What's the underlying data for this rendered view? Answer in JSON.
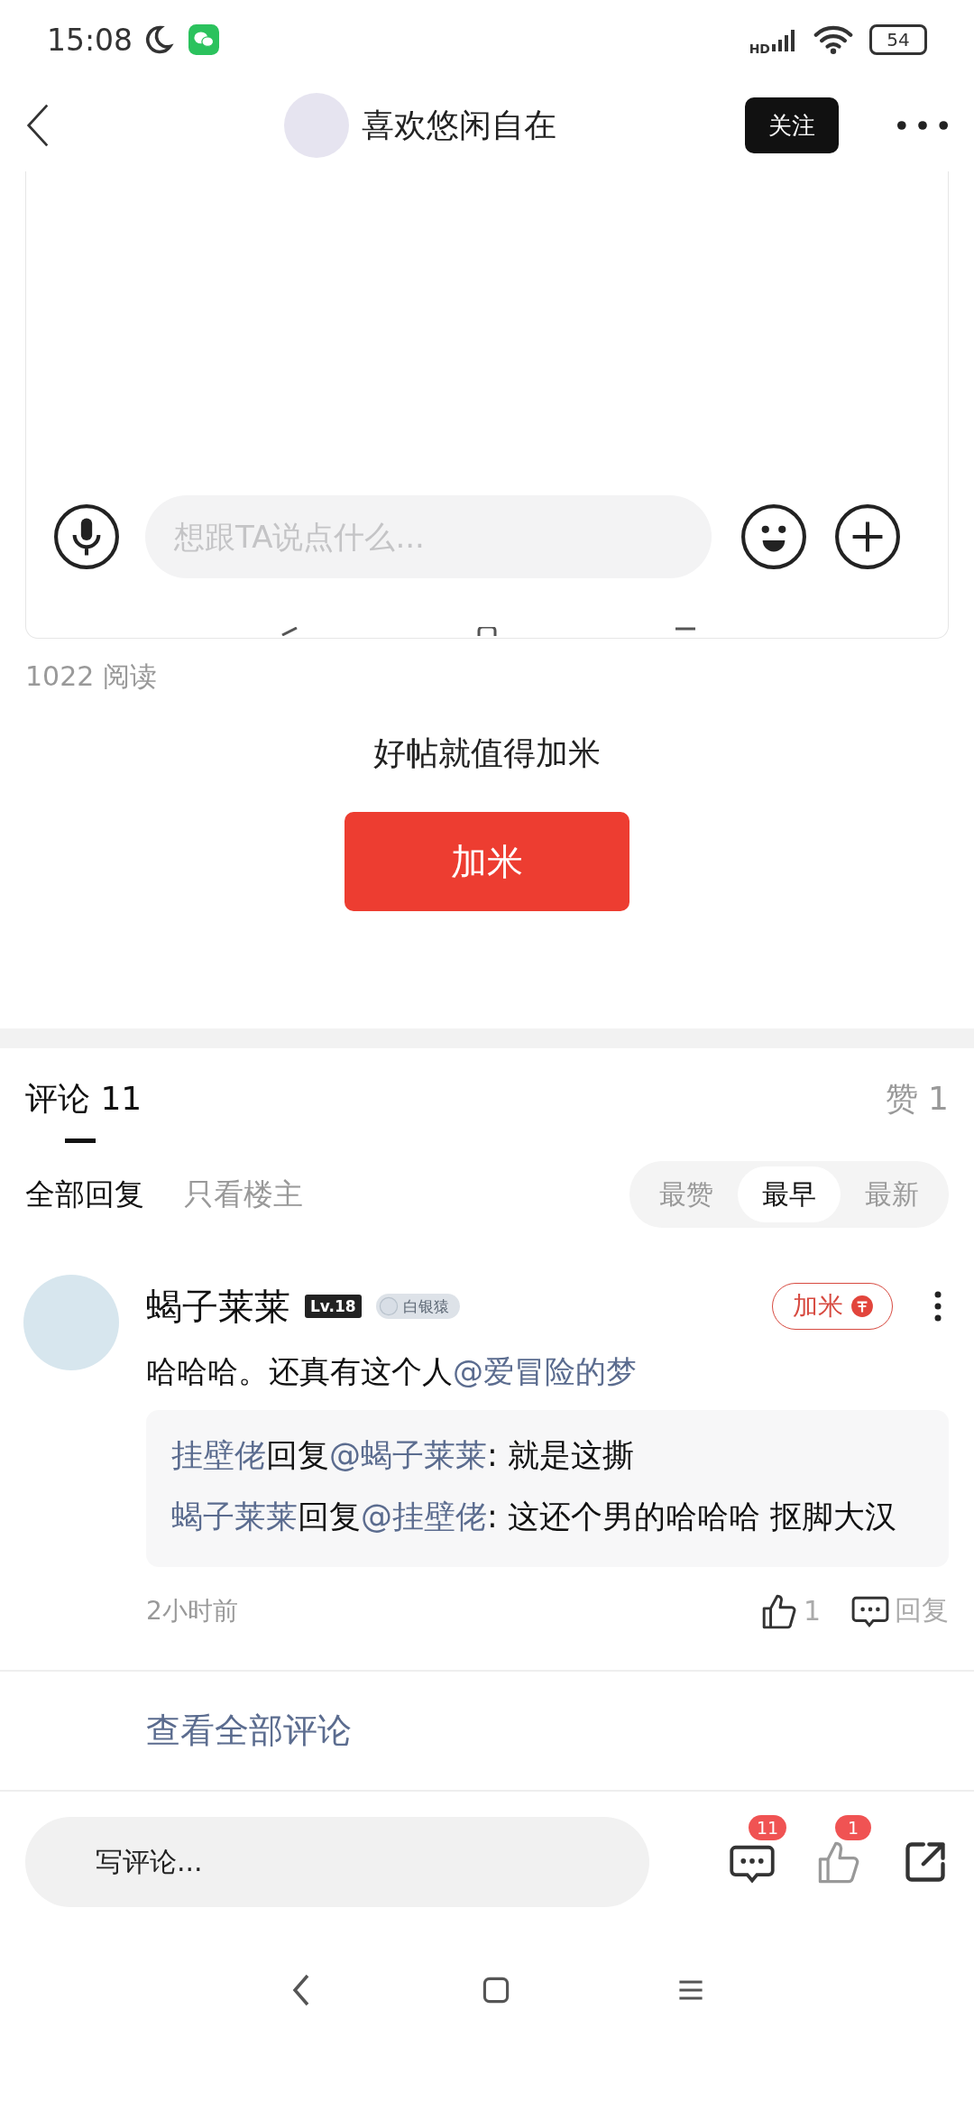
{
  "status_bar": {
    "time": "15:08",
    "network": "HD",
    "battery": "54"
  },
  "header": {
    "title": "喜欢悠闲自在",
    "follow_button": "关注"
  },
  "embedded_screenshot": {
    "placeholder": "想跟TA说点什么..."
  },
  "read_count": "1022 阅读",
  "reward": {
    "prompt": "好帖就值得加米",
    "button": "加米"
  },
  "tabs": [
    {
      "label": "评论 11",
      "selected": true
    },
    {
      "label": "赞 1",
      "selected": false
    }
  ],
  "filters": [
    {
      "label": "全部回复",
      "selected": true
    },
    {
      "label": "只看楼主",
      "selected": false
    }
  ],
  "sort": [
    {
      "label": "最赞",
      "selected": false
    },
    {
      "label": "最早",
      "selected": true
    },
    {
      "label": "最新",
      "selected": false
    }
  ],
  "comment": {
    "author": "蝎子莱莱",
    "level": "Lv.18",
    "badge": "白银猿",
    "reward_button": "加米",
    "text": "哈哈哈。还真有这个人",
    "mention": "@爱冒险的梦",
    "replies": [
      {
        "author": "挂壁佬",
        "verb": "回复",
        "target": "@蝎子莱莱",
        "text": ": 就是这撕"
      },
      {
        "author": "蝎子莱莱",
        "verb": "回复",
        "target": "@挂壁佬",
        "text": ": 这还个男的哈哈哈 抠脚大汉"
      }
    ],
    "time": "2小时前",
    "likes": "1",
    "reply_button": "回复"
  },
  "view_all": "查看全部评论",
  "bottom_bar": {
    "placeholder": "写评论...",
    "comment_count": "11",
    "like_count": "1"
  }
}
